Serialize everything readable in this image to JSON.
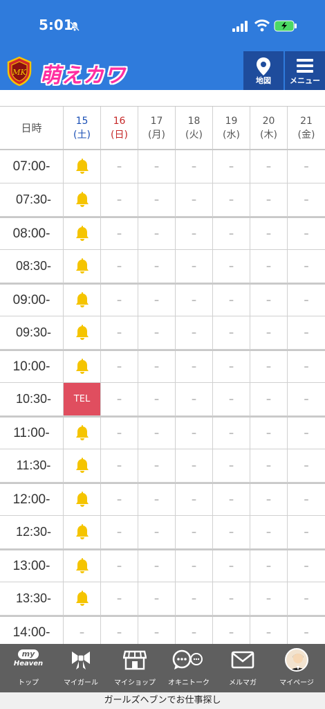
{
  "status_bar": {
    "time": "5:01"
  },
  "header": {
    "logo_text": "萌えカワ",
    "map_label": "地図",
    "menu_label": "メニュー"
  },
  "table": {
    "corner_label": "日時",
    "days": [
      {
        "date": "15",
        "weekday": "(土)"
      },
      {
        "date": "16",
        "weekday": "(日)"
      },
      {
        "date": "17",
        "weekday": "(月)"
      },
      {
        "date": "18",
        "weekday": "(火)"
      },
      {
        "date": "19",
        "weekday": "(水)"
      },
      {
        "date": "20",
        "weekday": "(木)"
      },
      {
        "date": "21",
        "weekday": "(金)"
      }
    ],
    "dash": "–",
    "tel": "TEL",
    "rows": [
      {
        "time": "07:00-",
        "first": "bell"
      },
      {
        "time": "07:30-",
        "first": "bell"
      },
      {
        "time": "08:00-",
        "first": "bell"
      },
      {
        "time": "08:30-",
        "first": "bell"
      },
      {
        "time": "09:00-",
        "first": "bell"
      },
      {
        "time": "09:30-",
        "first": "bell"
      },
      {
        "time": "10:00-",
        "first": "bell"
      },
      {
        "time": "10:30-",
        "first": "tel"
      },
      {
        "time": "11:00-",
        "first": "bell"
      },
      {
        "time": "11:30-",
        "first": "bell"
      },
      {
        "time": "12:00-",
        "first": "bell"
      },
      {
        "time": "12:30-",
        "first": "bell"
      },
      {
        "time": "13:00-",
        "first": "bell"
      },
      {
        "time": "13:30-",
        "first": "bell"
      },
      {
        "time": "14:00-",
        "first": "dash"
      }
    ]
  },
  "bottom_nav": {
    "items": [
      {
        "label": "トップ",
        "icon": "my-heaven-logo"
      },
      {
        "label": "マイガール",
        "icon": "ribbon-icon"
      },
      {
        "label": "マイショップ",
        "icon": "shop-icon"
      },
      {
        "label": "オキニトーク",
        "icon": "chat-icon"
      },
      {
        "label": "メルマガ",
        "icon": "mail-icon"
      },
      {
        "label": "マイページ",
        "icon": "avatar"
      }
    ],
    "myheaven_top": "my",
    "myheaven_bottom": "Heaven"
  },
  "footer": {
    "text": "ガールズヘブンでお仕事探し"
  },
  "colors": {
    "brand_blue": "#2f7bdc",
    "header_button": "#1e4c9c",
    "tel_red": "#e04e5f",
    "bell_yellow": "#f5c400",
    "nav_gray": "#5f5f5f"
  }
}
